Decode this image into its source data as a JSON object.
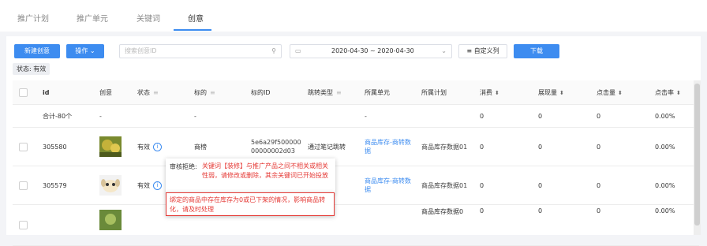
{
  "tabs": [
    "推广计划",
    "推广单元",
    "关键词",
    "创意"
  ],
  "toolbar": {
    "new_label": "新建创意",
    "op_label": "操作",
    "search_placeholder": "搜索创意ID",
    "date_range": "2020-04-30 ~ 2020-04-30",
    "custom_cols": "自定义列",
    "download": "下载"
  },
  "status_filter": "状态: 有效",
  "columns": [
    "id",
    "创意",
    "状态",
    "标的",
    "标的ID",
    "跳转类型",
    "所属单元",
    "所属计划",
    "消费",
    "展现量",
    "点击量",
    "点击率"
  ],
  "total": {
    "id": "合计-80个",
    "creative": "-",
    "target": "-",
    "unit": "-",
    "spend": "0",
    "impr": "0",
    "clicks": "0",
    "ctr": "0.00%"
  },
  "rows": [
    {
      "id": "305580",
      "status": "有效",
      "target": "商榜",
      "target_id": "5e6a29f50000000000002d03",
      "jump": "通过笔记跳转",
      "unit": "商品库存-商转数据",
      "plan": "商品库存数据01",
      "spend": "0",
      "impr": "0",
      "clicks": "0",
      "ctr": "0.00%"
    },
    {
      "id": "305579",
      "status": "有效",
      "target": "",
      "target_id": "",
      "jump": "记跳转",
      "unit": "商品库存-商转数据",
      "plan": "商品库存数据01",
      "spend": "0",
      "impr": "0",
      "clicks": "0",
      "ctr": "0.00%"
    },
    {
      "id": "",
      "status": "",
      "target": "",
      "target_id": "5e6b5458b0",
      "jump": "",
      "unit": "",
      "plan": "商品库存数据0",
      "spend": "0",
      "impr": "0",
      "clicks": "0",
      "ctr": "0.00%"
    }
  ],
  "tooltip": {
    "label": "审核拒绝:",
    "text": "关键词【装修】与推广产品之间不相关或相关性弱，请修改或删除，其余关键词已开始投放",
    "text2": "绑定的商品中存在库存为0或已下架的情况，影响商品转化，请及时处理"
  },
  "colors": {
    "accent": "#3d8cf0",
    "error": "#e53935"
  }
}
